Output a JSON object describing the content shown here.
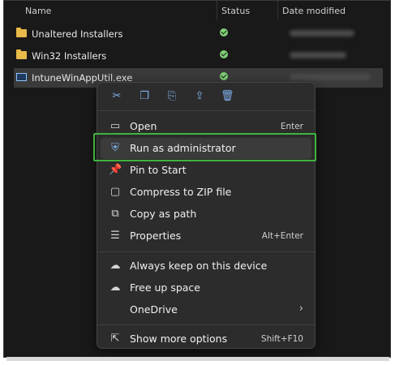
{
  "columns": {
    "name": "Name",
    "status": "Status",
    "date": "Date modified"
  },
  "files": [
    {
      "name": "Unaltered Installers",
      "icon": "folder-icon"
    },
    {
      "name": "Win32 Installers",
      "icon": "folder-icon"
    },
    {
      "name": "IntuneWinAppUtil.exe",
      "icon": "exe-file-icon"
    }
  ],
  "context_menu": {
    "toolbar": [
      "cut-icon",
      "copy-icon",
      "rename-icon",
      "share-icon",
      "delete-icon"
    ],
    "items": [
      {
        "label": "Open",
        "shortcut": "Enter",
        "icon": "window-icon"
      },
      {
        "label": "Run as administrator",
        "shortcut": "",
        "icon": "shield-icon"
      },
      {
        "label": "Pin to Start",
        "shortcut": "",
        "icon": "pin-icon"
      },
      {
        "label": "Compress to ZIP file",
        "shortcut": "",
        "icon": "zip-icon"
      },
      {
        "label": "Copy as path",
        "shortcut": "",
        "icon": "path-icon"
      },
      {
        "label": "Properties",
        "shortcut": "Alt+Enter",
        "icon": "properties-icon"
      },
      {
        "label": "Always keep on this device",
        "shortcut": "",
        "icon": "keep-sync-icon"
      },
      {
        "label": "Free up space",
        "shortcut": "",
        "icon": "cloud-icon"
      },
      {
        "label": "OneDrive",
        "shortcut": "",
        "icon": ""
      },
      {
        "label": "Show more options",
        "shortcut": "Shift+F10",
        "icon": "more-options-icon"
      }
    ]
  },
  "colors": {
    "highlight_box": "#3fb33f",
    "status_ok": "#7fce75",
    "accent_icon": "#7fb2ee"
  }
}
